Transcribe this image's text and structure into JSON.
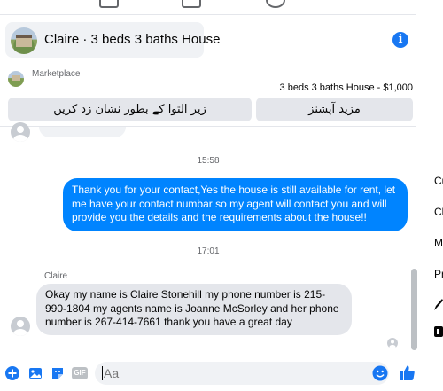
{
  "header": {
    "title": "Claire · 3 beds 3 baths House",
    "info_icon": "info-icon"
  },
  "marketplace": {
    "label": "Marketplace",
    "listing": "3 beds 3 baths House - $1,000",
    "buttons": {
      "report_label": "زیر التوا کے بطور نشان زد کریں",
      "more_label": "مزید آپشنز"
    }
  },
  "conversation": {
    "timestamps": [
      "15:58",
      "17:01"
    ],
    "messages": [
      {
        "direction": "outgoing",
        "text": "Thank you for your contact,Yes the house is still available for rent, let me have your contact numbar so my agent will contact you and will provide you the details and the requirements about the house!!"
      },
      {
        "direction": "incoming",
        "sender": "Claire",
        "text": "Okay my name is Claire Stonehill my phone number is 215-990-1804 my agents name is Joanne McSorley and her phone number is 267-414-7661 thank you have a great day"
      }
    ]
  },
  "composer": {
    "placeholder": "Aa",
    "icons": [
      "plus-icon",
      "photo-icon",
      "sticker-icon",
      "gif-icon",
      "emoji-icon",
      "like-icon"
    ],
    "gif_label": "GIF"
  },
  "side_panel": {
    "letters": [
      "Cu",
      "Cl",
      "M",
      "Pr"
    ]
  },
  "colors": {
    "accent": "#0084ff",
    "brand": "#1877f2",
    "incoming_bubble": "#e4e6eb",
    "button_bg": "#e4e6eb"
  }
}
